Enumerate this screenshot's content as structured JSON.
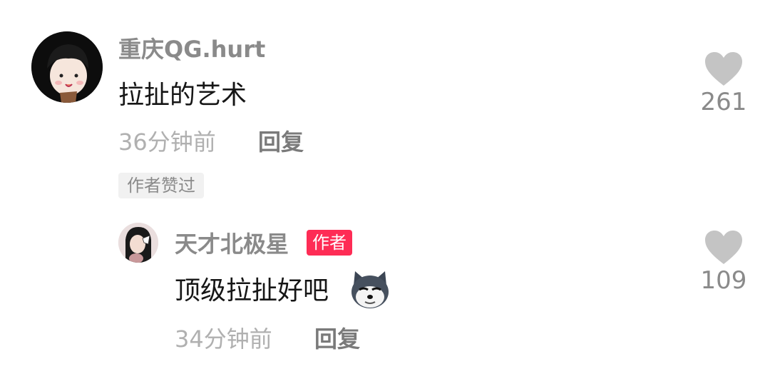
{
  "comments": [
    {
      "username": "重庆QG.hurt",
      "text": "拉扯的艺术",
      "time": "36分钟前",
      "reply_label": "回复",
      "liked_badge": "作者赞过",
      "likes": "261",
      "icon": "heart-icon"
    }
  ],
  "replies": [
    {
      "username": "天才北极星",
      "author_tag": "作者",
      "text": "顶级拉扯好吧",
      "emoji": "husky-dog-emoji",
      "time": "34分钟前",
      "reply_label": "回复",
      "likes": "109",
      "icon": "heart-icon"
    }
  ],
  "colors": {
    "author_tag": "#fe2c55",
    "heart": "#c4c4c4",
    "username": "#8a8a8a",
    "meta": "#b0b0b0"
  }
}
